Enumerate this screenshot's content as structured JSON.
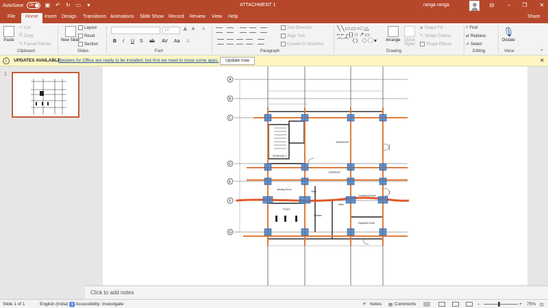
{
  "titlebar": {
    "autosave_label": "AutoSave",
    "autosave_state": "Off",
    "doc_title": "ATTACHMENT 1",
    "user_name": "ranga ranga"
  },
  "tabs": [
    "File",
    "Home",
    "Insert",
    "Design",
    "Transitions",
    "Animations",
    "Slide Show",
    "Record",
    "Review",
    "View",
    "Help"
  ],
  "share_label": "Share",
  "ribbon": {
    "clipboard": {
      "paste": "Paste",
      "cut": "Cut",
      "copy": "Copy",
      "format_painter": "Format Painter",
      "label": "Clipboard"
    },
    "slides": {
      "new_slide": "New Slide",
      "layout": "Layout",
      "reset": "Reset",
      "section": "Section",
      "label": "Slides"
    },
    "font": {
      "label": "Font",
      "size": "10"
    },
    "paragraph": {
      "text_direction": "Text Direction",
      "align_text": "Align Text",
      "convert_smartart": "Convert to SmartArt",
      "label": "Paragraph"
    },
    "drawing": {
      "arrange": "Arrange",
      "quick_styles": "Quick Styles",
      "shape_fill": "Shape Fill",
      "shape_outline": "Shape Outline",
      "shape_effects": "Shape Effects",
      "label": "Drawing"
    },
    "editing": {
      "find": "Find",
      "replace": "Replace",
      "select": "Select",
      "label": "Editing"
    },
    "voice": {
      "dictate": "Dictate",
      "label": "Voice"
    }
  },
  "notification": {
    "title": "UPDATES AVAILABLE",
    "message": "Updates for Office are ready to be installed, but first we need to close some apps.",
    "button": "Update now"
  },
  "slide_panel": {
    "slide_number": "1"
  },
  "notes_placeholder": "Click to add notes",
  "drawing": {
    "grid_labels": [
      "A",
      "B",
      "C",
      "D",
      "E",
      "F",
      "G"
    ],
    "room_labels": [
      "WORKSHOP",
      "STAIRCASE 1",
      "CORRIDOR",
      "Meeting Room",
      "Store",
      "Conference Room",
      "Office",
      "TOILET",
      "Canteen",
      "Equipment Room"
    ]
  },
  "status": {
    "slide_info": "Slide 1 of 1",
    "language": "English (India)",
    "accessibility": "Accessibility: Investigate",
    "notes": "Notes",
    "comments": "Comments",
    "zoom": "75%"
  },
  "colors": {
    "accent": "#b7472a",
    "notice_bg": "#fdf6c3",
    "beam": "#e07b39",
    "column": "#4a7ec0"
  }
}
